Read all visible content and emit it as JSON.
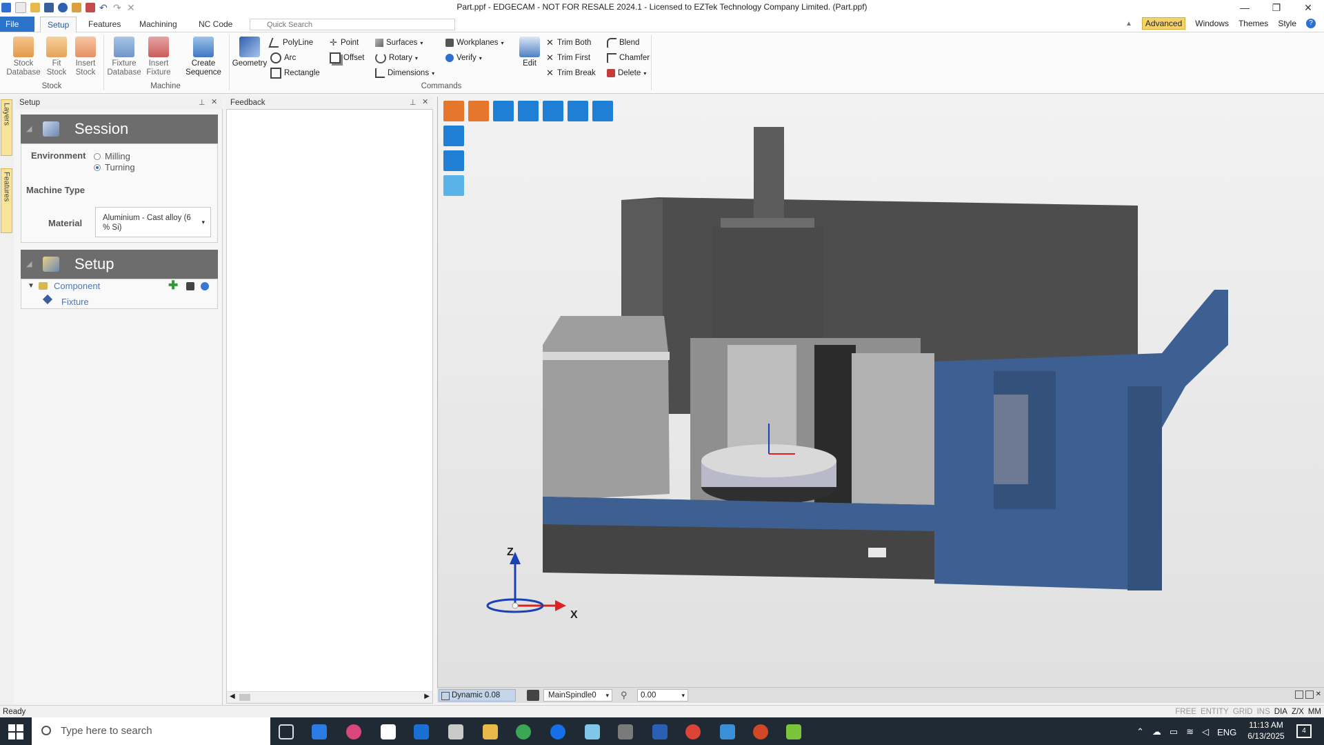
{
  "window": {
    "title": "Part.ppf - EDGECAM - NOT FOR RESALE 2024.1 - Licensed to EZTek Technology Company Limited. (Part.ppf)",
    "minimize": "—",
    "restore": "❐",
    "close": "✕"
  },
  "tabs": [
    {
      "label": "File"
    },
    {
      "label": "Setup"
    },
    {
      "label": "Features"
    },
    {
      "label": "Machining"
    },
    {
      "label": "NC Code"
    }
  ],
  "quick_search": {
    "placeholder": "Quick Search"
  },
  "right_menu": {
    "advanced": "Advanced",
    "windows": "Windows",
    "themes": "Themes",
    "style": "Style",
    "help": "?"
  },
  "ribbon": {
    "stock_database": "Stock Database",
    "fit_stock": "Fit Stock",
    "insert_stock": "Insert Stock",
    "fixture_database": "Fixture Database",
    "insert_fixture": "Insert Fixture",
    "create_sequence": "Create Sequence",
    "geometry": "Geometry",
    "polyline": "PolyLine",
    "arc": "Arc",
    "rectangle": "Rectangle",
    "point": "Point",
    "offset": "Offset",
    "surfaces": "Surfaces",
    "rotary": "Rotary",
    "dimensions": "Dimensions",
    "workplanes": "Workplanes",
    "verify": "Verify",
    "edit": "Edit",
    "trim_both": "Trim Both",
    "trim_first": "Trim First",
    "trim_break": "Trim Break",
    "blend": "Blend",
    "chamfer": "Chamfer",
    "delete": "Delete",
    "group_stock": "Stock",
    "group_machine": "Machine",
    "group_commands": "Commands"
  },
  "side_tabs": {
    "layers": "Layers",
    "features": "Features"
  },
  "setup_panel": {
    "title": "Setup",
    "session": {
      "heading": "Session",
      "environment_label": "Environment",
      "milling": "Milling",
      "turning": "Turning",
      "selected": "Turning",
      "machine_type_label": "Machine Type",
      "material_label": "Material",
      "material_value": "Aluminium - Cast alloy (6 % Si)"
    },
    "setup": {
      "heading": "Setup",
      "component": "Component",
      "fixture": "Fixture"
    }
  },
  "feedback_panel": {
    "title": "Feedback"
  },
  "viewport": {
    "axis_z": "Z",
    "axis_x": "X",
    "status": {
      "dynamic": "Dynamic 0.08",
      "spindle": "MainSpindle0",
      "value": "0.00"
    }
  },
  "statusbar": {
    "left": "Ready",
    "modes": [
      "FREE",
      "ENTITY",
      "GRID",
      "INS",
      "DIA",
      "Z/X",
      "MM"
    ]
  },
  "taskbar": {
    "search_placeholder": "Type here to search",
    "lang": "ENG",
    "time": "11:13 AM",
    "date": "6/13/2025",
    "notifications": "4"
  },
  "colors": {
    "accent": "#2b74c9",
    "session_header": "#6d6d6d",
    "machine_blue": "#3e5f91",
    "viewport_tool": "#1e7fd4"
  }
}
